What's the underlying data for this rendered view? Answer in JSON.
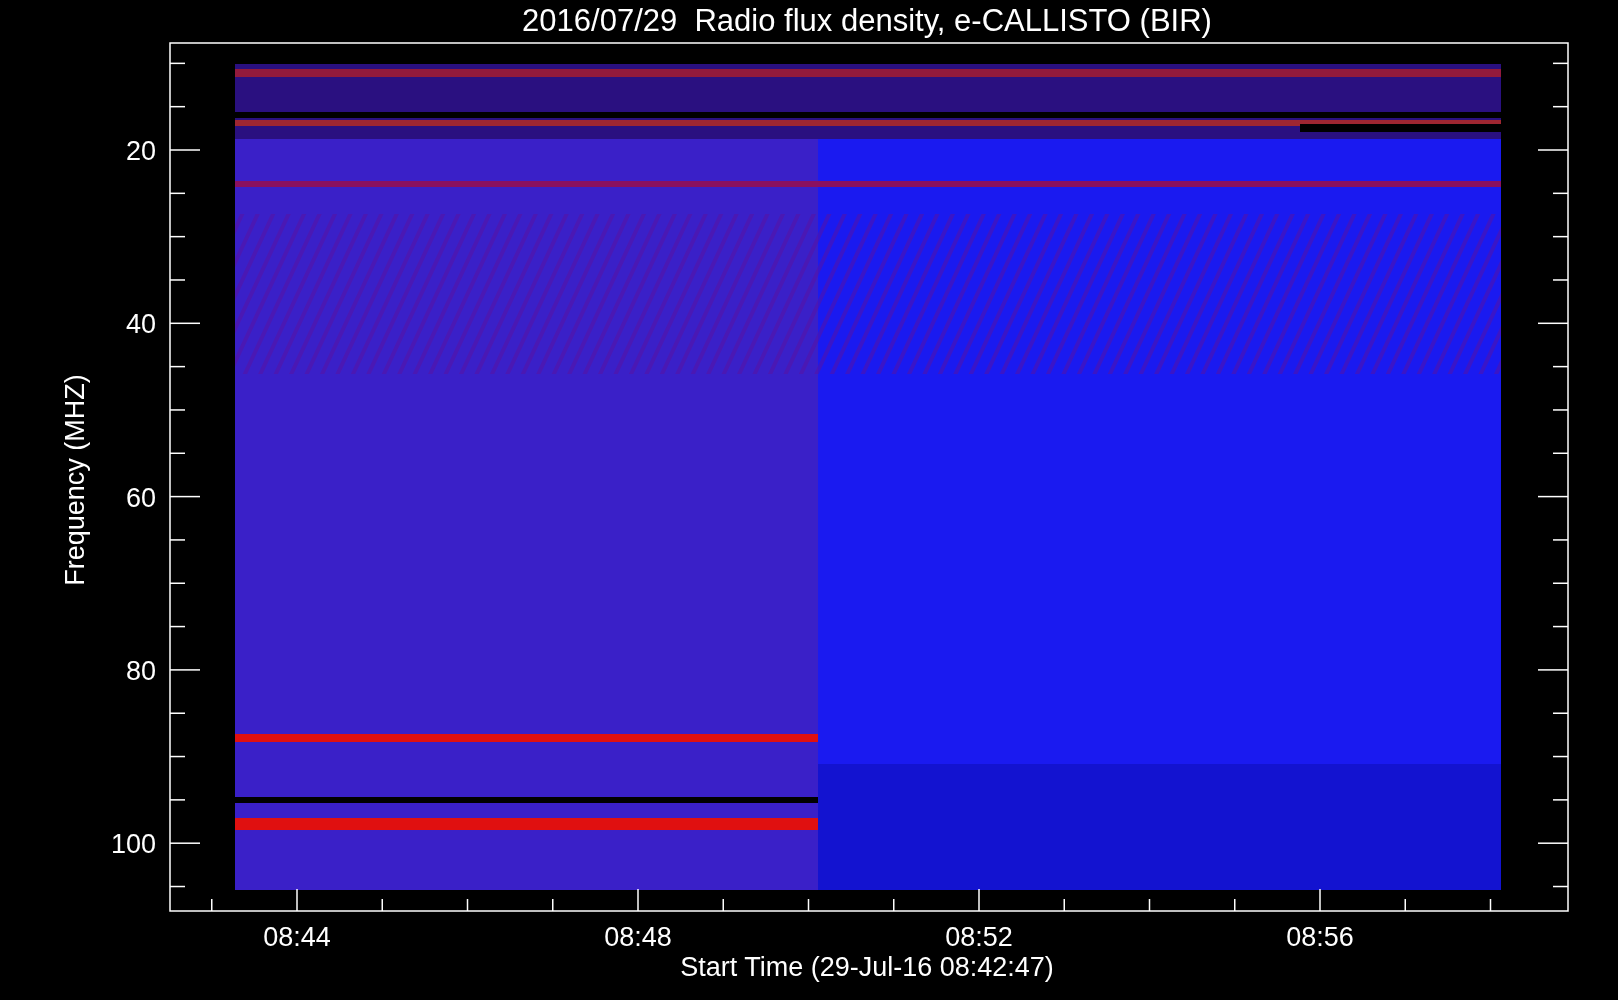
{
  "title": "2016/07/29  Radio flux density, e-CALLISTO (BIR)",
  "y_axis": {
    "label": "Frequency (MHZ)",
    "tick_labels": [
      "20",
      "40",
      "60",
      "80",
      "100"
    ]
  },
  "x_axis": {
    "label": "Start Time (29-Jul-16 08:42:47)",
    "tick_labels": [
      "08:44",
      "08:48",
      "08:52",
      "08:56"
    ]
  }
}
